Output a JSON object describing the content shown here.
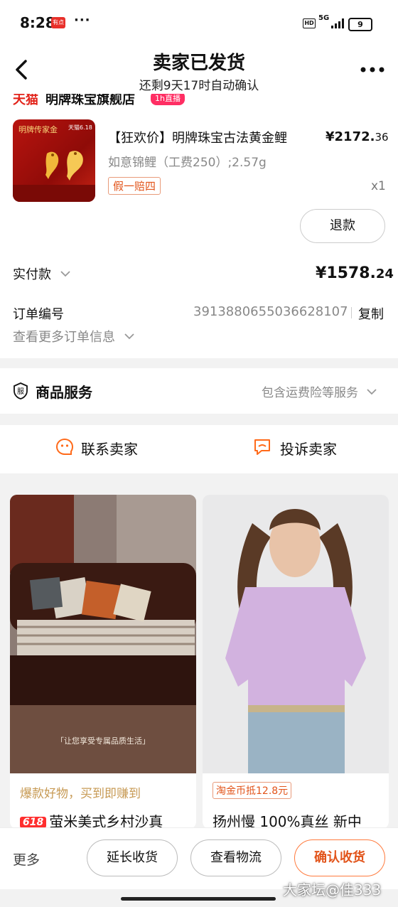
{
  "status_bar": {
    "time": "8:28",
    "app_badge": "有点",
    "dots": "···",
    "hd": "HD",
    "network": "5G",
    "battery": "9"
  },
  "header": {
    "title": "卖家已发货",
    "subtitle": "还剩9天17时自动确认"
  },
  "store": {
    "platform": "天猫",
    "name": "明牌珠宝旗舰店",
    "tag": "1h直播"
  },
  "product": {
    "thumb_text1": "明牌传家金",
    "thumb_text2": "天猫6.18",
    "name": "【狂欢价】明牌珠宝古法黄金鲤",
    "price_currency": "¥",
    "price_int": "2172.",
    "price_dec": "36",
    "spec": "如意锦鲤（工费250）;2.57g",
    "tag": "假一赔四",
    "qty": "x1",
    "refund_label": "退款"
  },
  "payment": {
    "label": "实付款",
    "currency": "¥",
    "value_int": "1578.",
    "value_dec": "24"
  },
  "order": {
    "label": "订单编号",
    "number": "3913880655036628107",
    "copy_label": "复制",
    "more_label": "查看更多订单信息"
  },
  "service": {
    "icon_char": "服",
    "label": "商品服务",
    "summary": "包含运费险等服务"
  },
  "contact": {
    "seller_label": "联系卖家",
    "complain_label": "投诉卖家"
  },
  "recommend": [
    {
      "caption": "爆款好物，买到即赚到",
      "badge": "618",
      "title": "萤米美式乡村沙真",
      "img_text": "「让您享受专属品质生活」"
    },
    {
      "badge": "淘金币抵12.8元",
      "title": "扬州慢 100%真丝 新中"
    }
  ],
  "bottom_bar": {
    "more": "更多",
    "extend": "延长收货",
    "logistics": "查看物流",
    "confirm": "确认收货"
  },
  "watermark": "大家坛@佳333",
  "colors": {
    "accent": "#e2541a",
    "primary_border": "#ff7a3d",
    "gold": "#c79a54",
    "tmall_red": "#e2231a"
  }
}
